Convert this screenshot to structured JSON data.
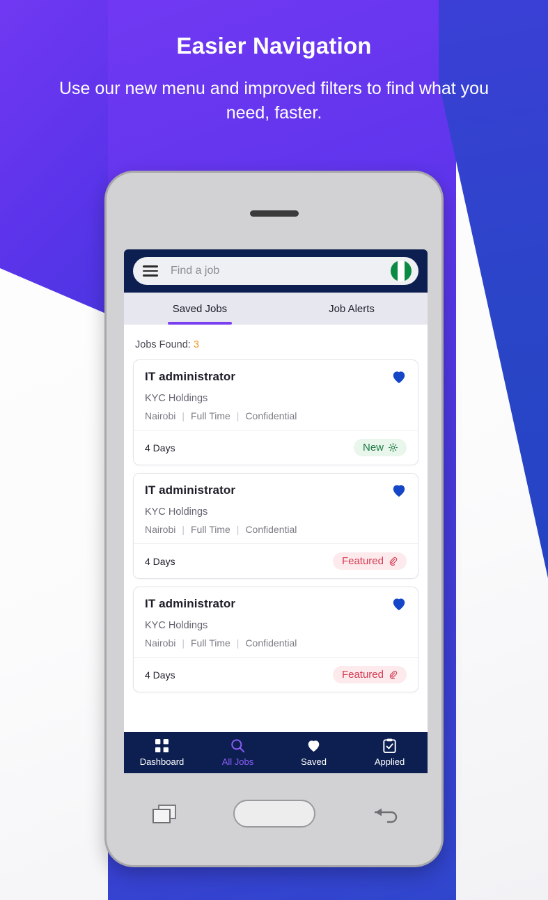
{
  "promo": {
    "title": "Easier Navigation",
    "subtitle": "Use our new menu and improved filters to find what you need, faster."
  },
  "colors": {
    "bg_gradient_start": "#7138f2",
    "bg_gradient_end": "#2444c4",
    "app_header": "#0d1f51",
    "tab_accent": "#7b3ff2",
    "heart": "#1546c8",
    "badge_new_text": "#1f7a45",
    "badge_new_bg": "#e9f6ec",
    "badge_featured_text": "#d33a52",
    "badge_featured_bg": "#fdeaec",
    "count_accent": "#eb9a22",
    "nav_active": "#8a5cf6"
  },
  "app": {
    "header": {
      "menu_icon": "hamburger-icon",
      "search_placeholder": "Find a job",
      "search_value": "",
      "flag_icon": "nigeria-flag-icon"
    },
    "tabs": [
      {
        "label": "Saved Jobs",
        "active": true
      },
      {
        "label": "Job Alerts",
        "active": false
      }
    ],
    "results": {
      "label": "Jobs Found:",
      "count": "3"
    },
    "jobs": [
      {
        "title": "IT administrator",
        "company": "KYC Holdings",
        "location": "Nairobi",
        "type": "Full Time",
        "salary": "Confidential",
        "posted": "4 Days",
        "badge": "New",
        "badge_kind": "new",
        "badge_icon": "sparkle-icon",
        "saved": true,
        "save_icon": "heart-filled-icon"
      },
      {
        "title": "IT administrator",
        "company": "KYC Holdings",
        "location": "Nairobi",
        "type": "Full Time",
        "salary": "Confidential",
        "posted": "4 Days",
        "badge": "Featured",
        "badge_kind": "featured",
        "badge_icon": "paperclip-icon",
        "saved": true,
        "save_icon": "heart-filled-icon"
      },
      {
        "title": "IT administrator",
        "company": "KYC Holdings",
        "location": "Nairobi",
        "type": "Full Time",
        "salary": "Confidential",
        "posted": "4 Days",
        "badge": "Featured",
        "badge_kind": "featured",
        "badge_icon": "paperclip-icon",
        "saved": true,
        "save_icon": "heart-filled-icon"
      }
    ],
    "bottom_nav": [
      {
        "label": "Dashboard",
        "icon": "grid-icon",
        "active": false
      },
      {
        "label": "All Jobs",
        "icon": "search-icon",
        "active": true
      },
      {
        "label": "Saved",
        "icon": "heart-icon",
        "active": false
      },
      {
        "label": "Applied",
        "icon": "clipboard-check-icon",
        "active": false
      }
    ]
  },
  "device": {
    "recents_icon": "recent-apps-icon",
    "home_icon": "home-button-icon",
    "back_icon": "back-arrow-icon"
  }
}
